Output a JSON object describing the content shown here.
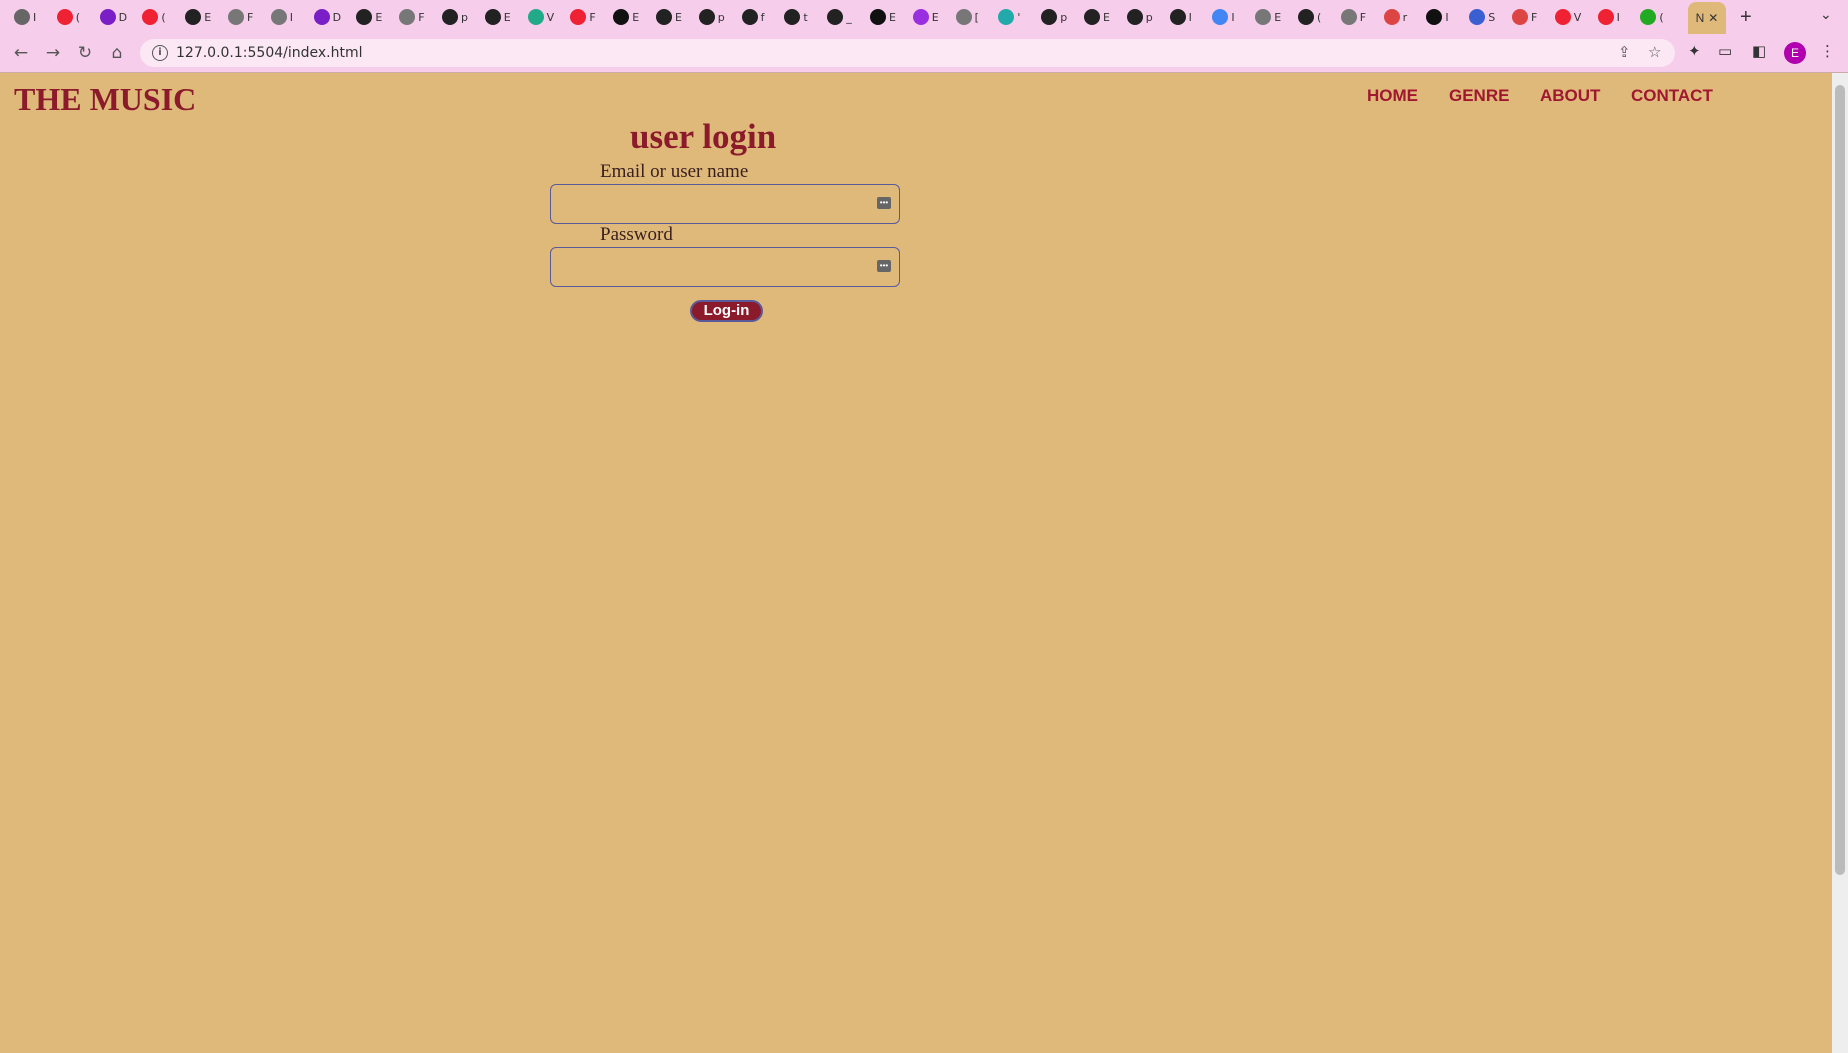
{
  "browser": {
    "tabs": [
      {
        "icon": "chrome-icon",
        "label": "I",
        "color": "#666"
      },
      {
        "icon": "opera-icon",
        "label": "(",
        "color": "#e23"
      },
      {
        "icon": "list-icon",
        "label": "D",
        "color": "#7a1fc7"
      },
      {
        "icon": "opera-icon",
        "label": "(",
        "color": "#e23"
      },
      {
        "icon": "github-icon",
        "label": "E",
        "color": "#222"
      },
      {
        "icon": "globe-icon",
        "label": "F",
        "color": "#777"
      },
      {
        "icon": "globe-icon",
        "label": "I",
        "color": "#777"
      },
      {
        "icon": "list-icon",
        "label": "D",
        "color": "#7a1fc7"
      },
      {
        "icon": "github-icon",
        "label": "E",
        "color": "#222"
      },
      {
        "icon": "globe-icon",
        "label": "F",
        "color": "#777"
      },
      {
        "icon": "github-icon",
        "label": "p",
        "color": "#222"
      },
      {
        "icon": "github-icon",
        "label": "E",
        "color": "#222"
      },
      {
        "icon": "w-icon",
        "label": "V",
        "color": "#2a8"
      },
      {
        "icon": "opera-icon",
        "label": "F",
        "color": "#e23"
      },
      {
        "icon": "m-icon",
        "label": "E",
        "color": "#111"
      },
      {
        "icon": "github-icon",
        "label": "E",
        "color": "#222"
      },
      {
        "icon": "github-icon",
        "label": "p",
        "color": "#222"
      },
      {
        "icon": "github-icon",
        "label": "f",
        "color": "#222"
      },
      {
        "icon": "github-icon",
        "label": "t",
        "color": "#222"
      },
      {
        "icon": "github-icon",
        "label": "_",
        "color": "#222"
      },
      {
        "icon": "a-icon",
        "label": "E",
        "color": "#111"
      },
      {
        "icon": "b-icon",
        "label": "E",
        "color": "#9a2fe0"
      },
      {
        "icon": "globe-icon",
        "label": "[",
        "color": "#777"
      },
      {
        "icon": "d-icon",
        "label": "'",
        "color": "#2aa"
      },
      {
        "icon": "github-icon",
        "label": "p",
        "color": "#222"
      },
      {
        "icon": "github-icon",
        "label": "E",
        "color": "#222"
      },
      {
        "icon": "github-icon",
        "label": "p",
        "color": "#222"
      },
      {
        "icon": "github-icon",
        "label": "I",
        "color": "#222"
      },
      {
        "icon": "google-icon",
        "label": "I",
        "color": "#4285f4"
      },
      {
        "icon": "globe-icon",
        "label": "E",
        "color": "#777"
      },
      {
        "icon": "github-icon",
        "label": "(",
        "color": "#222"
      },
      {
        "icon": "globe-icon",
        "label": "F",
        "color": "#777"
      },
      {
        "icon": "gmail-icon",
        "label": "r",
        "color": "#d44"
      },
      {
        "icon": "media-icon",
        "label": "I",
        "color": "#111"
      },
      {
        "icon": "list-icon",
        "label": "S",
        "color": "#3a5fd0"
      },
      {
        "icon": "gmail-icon",
        "label": "F",
        "color": "#d44"
      },
      {
        "icon": "opera-icon",
        "label": "V",
        "color": "#e23"
      },
      {
        "icon": "opera-icon",
        "label": "I",
        "color": "#e23"
      },
      {
        "icon": "drive-icon",
        "label": "(",
        "color": "#2a2"
      }
    ],
    "active_tab": {
      "label": "N",
      "close": "✕"
    },
    "new_tab": "+",
    "tab_menu": "⌄",
    "url": "127.0.0.1:5504/index.html",
    "profile_initial": "E"
  },
  "site": {
    "brand": "THE MUSIC",
    "nav": [
      "HOME",
      "GENRE",
      "ABOUT",
      "CONTACT"
    ],
    "form": {
      "title": "user login",
      "email_label": "Email or user name",
      "password_label": "Password",
      "submit": "Log-in"
    }
  }
}
